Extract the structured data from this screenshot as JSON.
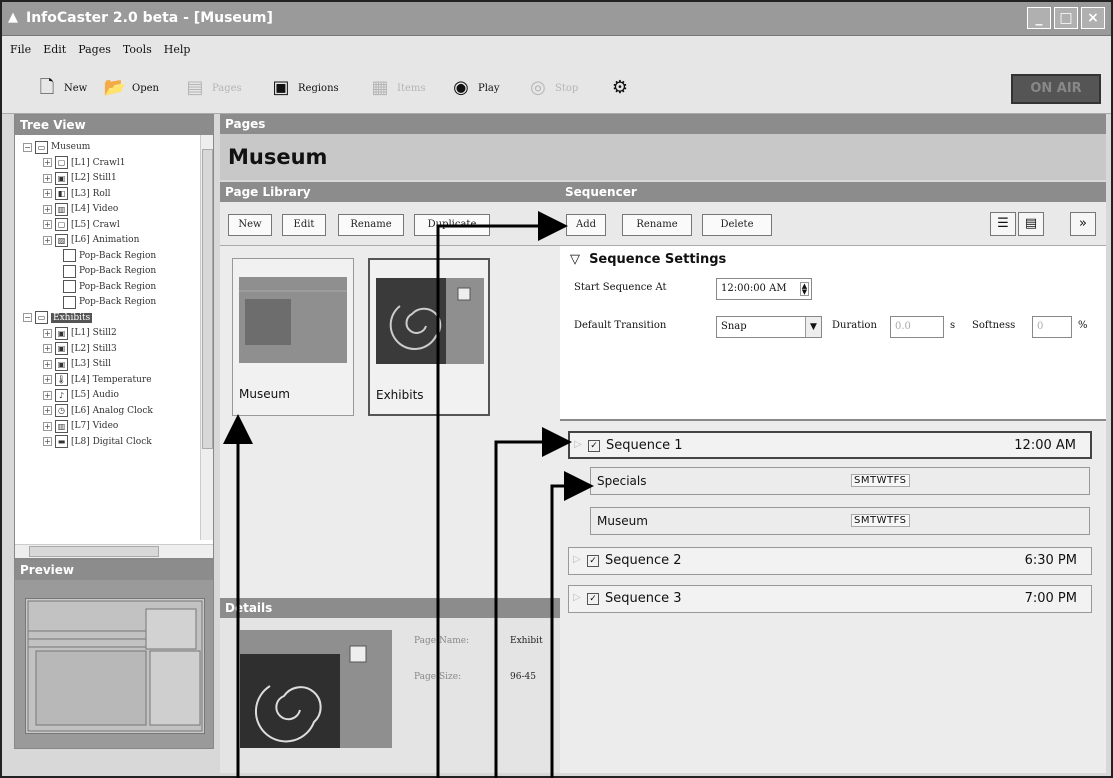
{
  "window": {
    "title": "InfoCaster 2.0 beta - [Museum]",
    "buttons": [
      "_",
      "□",
      "×"
    ]
  },
  "menu": [
    "File",
    "Edit",
    "Pages",
    "Tools",
    "Help"
  ],
  "toolbar": {
    "items": [
      {
        "label": "New",
        "icon": "new-icon",
        "glyph": "🗋",
        "enabled": true
      },
      {
        "label": "Open",
        "icon": "open-icon",
        "glyph": "📂",
        "enabled": true
      },
      {
        "label": "Pages",
        "icon": "pages-icon",
        "glyph": "▤",
        "enabled": false
      },
      {
        "label": "Regions",
        "icon": "regions-icon",
        "glyph": "▣",
        "enabled": true
      },
      {
        "label": "Items",
        "icon": "items-icon",
        "glyph": "▦",
        "enabled": false
      },
      {
        "label": "Play",
        "icon": "play-icon",
        "glyph": "◉",
        "enabled": true
      },
      {
        "label": "Stop",
        "icon": "stop-icon",
        "glyph": "◎",
        "enabled": false
      },
      {
        "label": "",
        "icon": "settings-icon",
        "glyph": "⚙",
        "enabled": true
      }
    ],
    "on_air": "ON AIR"
  },
  "tree_view": {
    "title": "Tree View",
    "rows": [
      {
        "label": "Museum",
        "icon": "page-icon",
        "glyph": "▭",
        "level": 0,
        "expander": "−"
      },
      {
        "label": "[L1] Crawl1",
        "icon": "crawl-icon",
        "glyph": "▢",
        "level": 1,
        "expander": "+"
      },
      {
        "label": "[L2] Still1",
        "icon": "still-icon",
        "glyph": "▣",
        "level": 1,
        "expander": "+"
      },
      {
        "label": "[L3] Roll",
        "icon": "roll-icon",
        "glyph": "◧",
        "level": 1,
        "expander": "+"
      },
      {
        "label": "[L4] Video",
        "icon": "video-icon",
        "glyph": "▥",
        "level": 1,
        "expander": "+"
      },
      {
        "label": "[L5] Crawl",
        "icon": "crawl-icon",
        "glyph": "▢",
        "level": 1,
        "expander": "+"
      },
      {
        "label": "[L6] Animation",
        "icon": "animation-icon",
        "glyph": "▨",
        "level": 1,
        "expander": "+"
      },
      {
        "label": "Pop-Back Region",
        "icon": "region-icon",
        "glyph": "",
        "level": 2,
        "expander": ""
      },
      {
        "label": "Pop-Back Region",
        "icon": "region-icon",
        "glyph": "",
        "level": 2,
        "expander": ""
      },
      {
        "label": "Pop-Back Region",
        "icon": "region-icon",
        "glyph": "",
        "level": 2,
        "expander": ""
      },
      {
        "label": "Pop-Back Region",
        "icon": "region-icon",
        "glyph": "",
        "level": 2,
        "expander": ""
      },
      {
        "label": "Exhibits",
        "icon": "page-icon",
        "glyph": "▭",
        "level": 0,
        "expander": "−",
        "selected": true
      },
      {
        "label": "[L1] Still2",
        "icon": "still-icon",
        "glyph": "▣",
        "level": 1,
        "expander": "+"
      },
      {
        "label": "[L2] Still3",
        "icon": "still-icon",
        "glyph": "▣",
        "level": 1,
        "expander": "+"
      },
      {
        "label": "[L3] Still",
        "icon": "still-icon",
        "glyph": "▣",
        "level": 1,
        "expander": "+"
      },
      {
        "label": "[L4] Temperature",
        "icon": "temperature-icon",
        "glyph": "🌡",
        "level": 1,
        "expander": "+"
      },
      {
        "label": "[L5] Audio",
        "icon": "audio-icon",
        "glyph": "♪",
        "level": 1,
        "expander": "+"
      },
      {
        "label": "[L6] Analog Clock",
        "icon": "analog-clock-icon",
        "glyph": "◷",
        "level": 1,
        "expander": "+"
      },
      {
        "label": "[L7] Video",
        "icon": "video-icon",
        "glyph": "▥",
        "level": 1,
        "expander": "+"
      },
      {
        "label": "[L8] Digital Clock",
        "icon": "digital-clock-icon",
        "glyph": "▬",
        "level": 1,
        "expander": "+"
      }
    ]
  },
  "preview": {
    "title": "Preview"
  },
  "pages": {
    "header": "Pages",
    "title": "Museum"
  },
  "library": {
    "header": "Page Library",
    "buttons": [
      "New",
      "Edit",
      "Rename",
      "Duplicate"
    ],
    "pages": [
      {
        "label": "Museum",
        "selected": false
      },
      {
        "label": "Exhibits",
        "selected": true
      }
    ]
  },
  "details": {
    "header": "Details",
    "page_name_label": "Page Name:",
    "page_name": "Exhibit",
    "page_size_label": "Page Size:",
    "page_size": "96-45"
  },
  "sequencer": {
    "header": "Sequencer",
    "buttons": [
      "Add",
      "Rename",
      "Delete"
    ],
    "icon_buttons": [
      {
        "icon": "list-view-icon",
        "glyph": "☰"
      },
      {
        "icon": "properties-icon",
        "glyph": "▤"
      },
      {
        "icon": "expand-icon",
        "glyph": "»"
      }
    ],
    "settings": {
      "title": "Sequence Settings",
      "start_label": "Start Sequence At",
      "start_value": "12:00:00 AM",
      "transition_label": "Default Transition",
      "transition_value": "Snap",
      "duration_label": "Duration",
      "duration_value": "0.0",
      "duration_unit": "s",
      "softness_label": "Softness",
      "softness_value": "0",
      "softness_unit": "%"
    },
    "sequences": [
      {
        "name": "Sequence 1",
        "time": "12:00 AM",
        "checked": true,
        "selected": true,
        "pages": [
          {
            "name": "Specials",
            "days": "SMTWTFS"
          },
          {
            "name": "Museum",
            "days": "SMTWTFS"
          }
        ]
      },
      {
        "name": "Sequence 2",
        "time": "6:30 PM",
        "checked": true,
        "selected": false,
        "pages": []
      },
      {
        "name": "Sequence 3",
        "time": "7:00 PM",
        "checked": true,
        "selected": false,
        "pages": []
      }
    ]
  }
}
